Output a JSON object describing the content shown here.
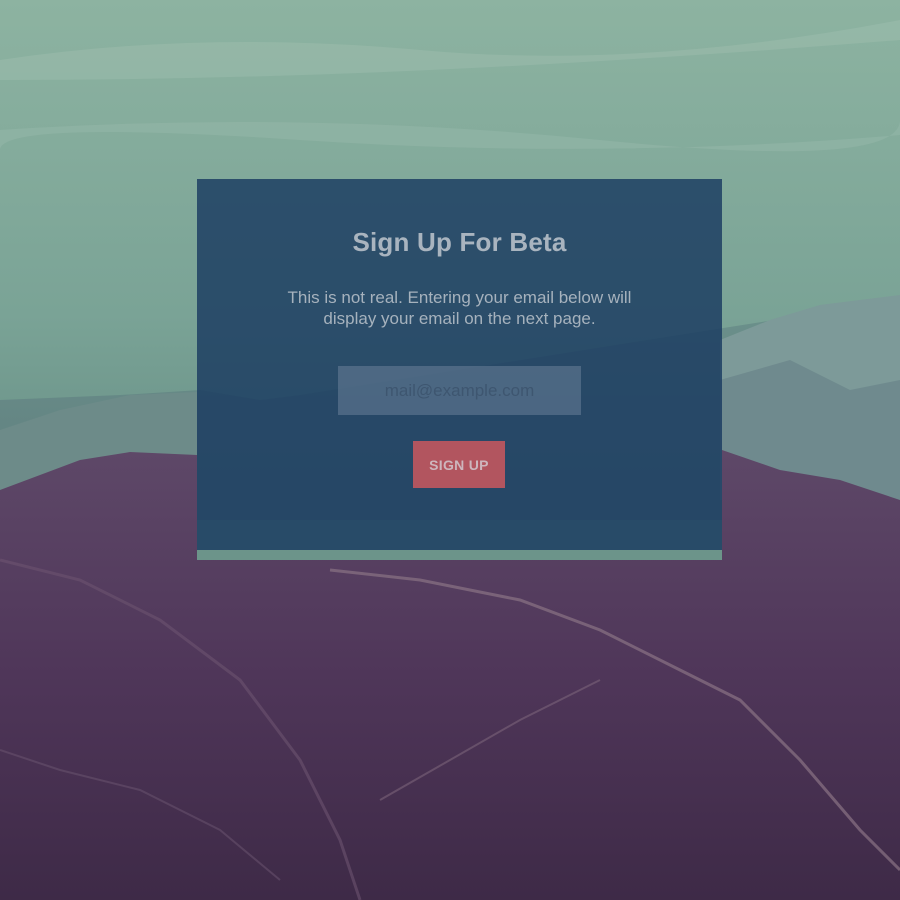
{
  "signup": {
    "title": "Sign Up For Beta",
    "description": "This is not real. Entering your email below will display your email on the next page.",
    "email_placeholder": "mail@example.com",
    "email_value": "",
    "button_label": "SIGN UP"
  },
  "colors": {
    "card_background": "#1a3a60",
    "button": "#b2555f",
    "sky": "#8fb3a2",
    "mountains": "#4e3758"
  },
  "background": {
    "icon": "mountain-landscape-photo"
  }
}
